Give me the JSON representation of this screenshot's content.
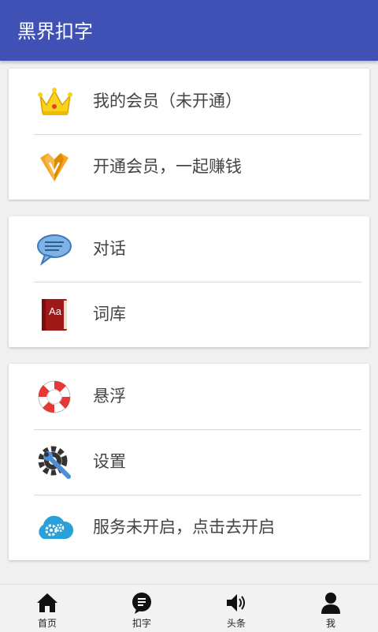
{
  "appbar": {
    "title": "黑界扣字"
  },
  "card1": {
    "items": [
      {
        "label": "我的会员（未开通）",
        "icon": "crown-icon"
      },
      {
        "label": "开通会员，一起赚钱",
        "icon": "diamond-icon"
      }
    ]
  },
  "card2": {
    "items": [
      {
        "label": "对话",
        "icon": "chat-bubble-icon"
      },
      {
        "label": "词库",
        "icon": "dictionary-book-icon"
      }
    ]
  },
  "card3": {
    "items": [
      {
        "label": "悬浮",
        "icon": "lifebuoy-icon"
      },
      {
        "label": "设置",
        "icon": "gear-wrench-icon"
      },
      {
        "label": "服务未开启，点击去开启",
        "icon": "cloud-gears-icon"
      }
    ]
  },
  "book_icon_text": "Aa",
  "bottomnav": {
    "items": [
      {
        "label": "首页",
        "icon": "home-icon"
      },
      {
        "label": "扣字",
        "icon": "message-icon"
      },
      {
        "label": "头条",
        "icon": "speaker-icon"
      },
      {
        "label": "我",
        "icon": "person-icon"
      }
    ]
  }
}
